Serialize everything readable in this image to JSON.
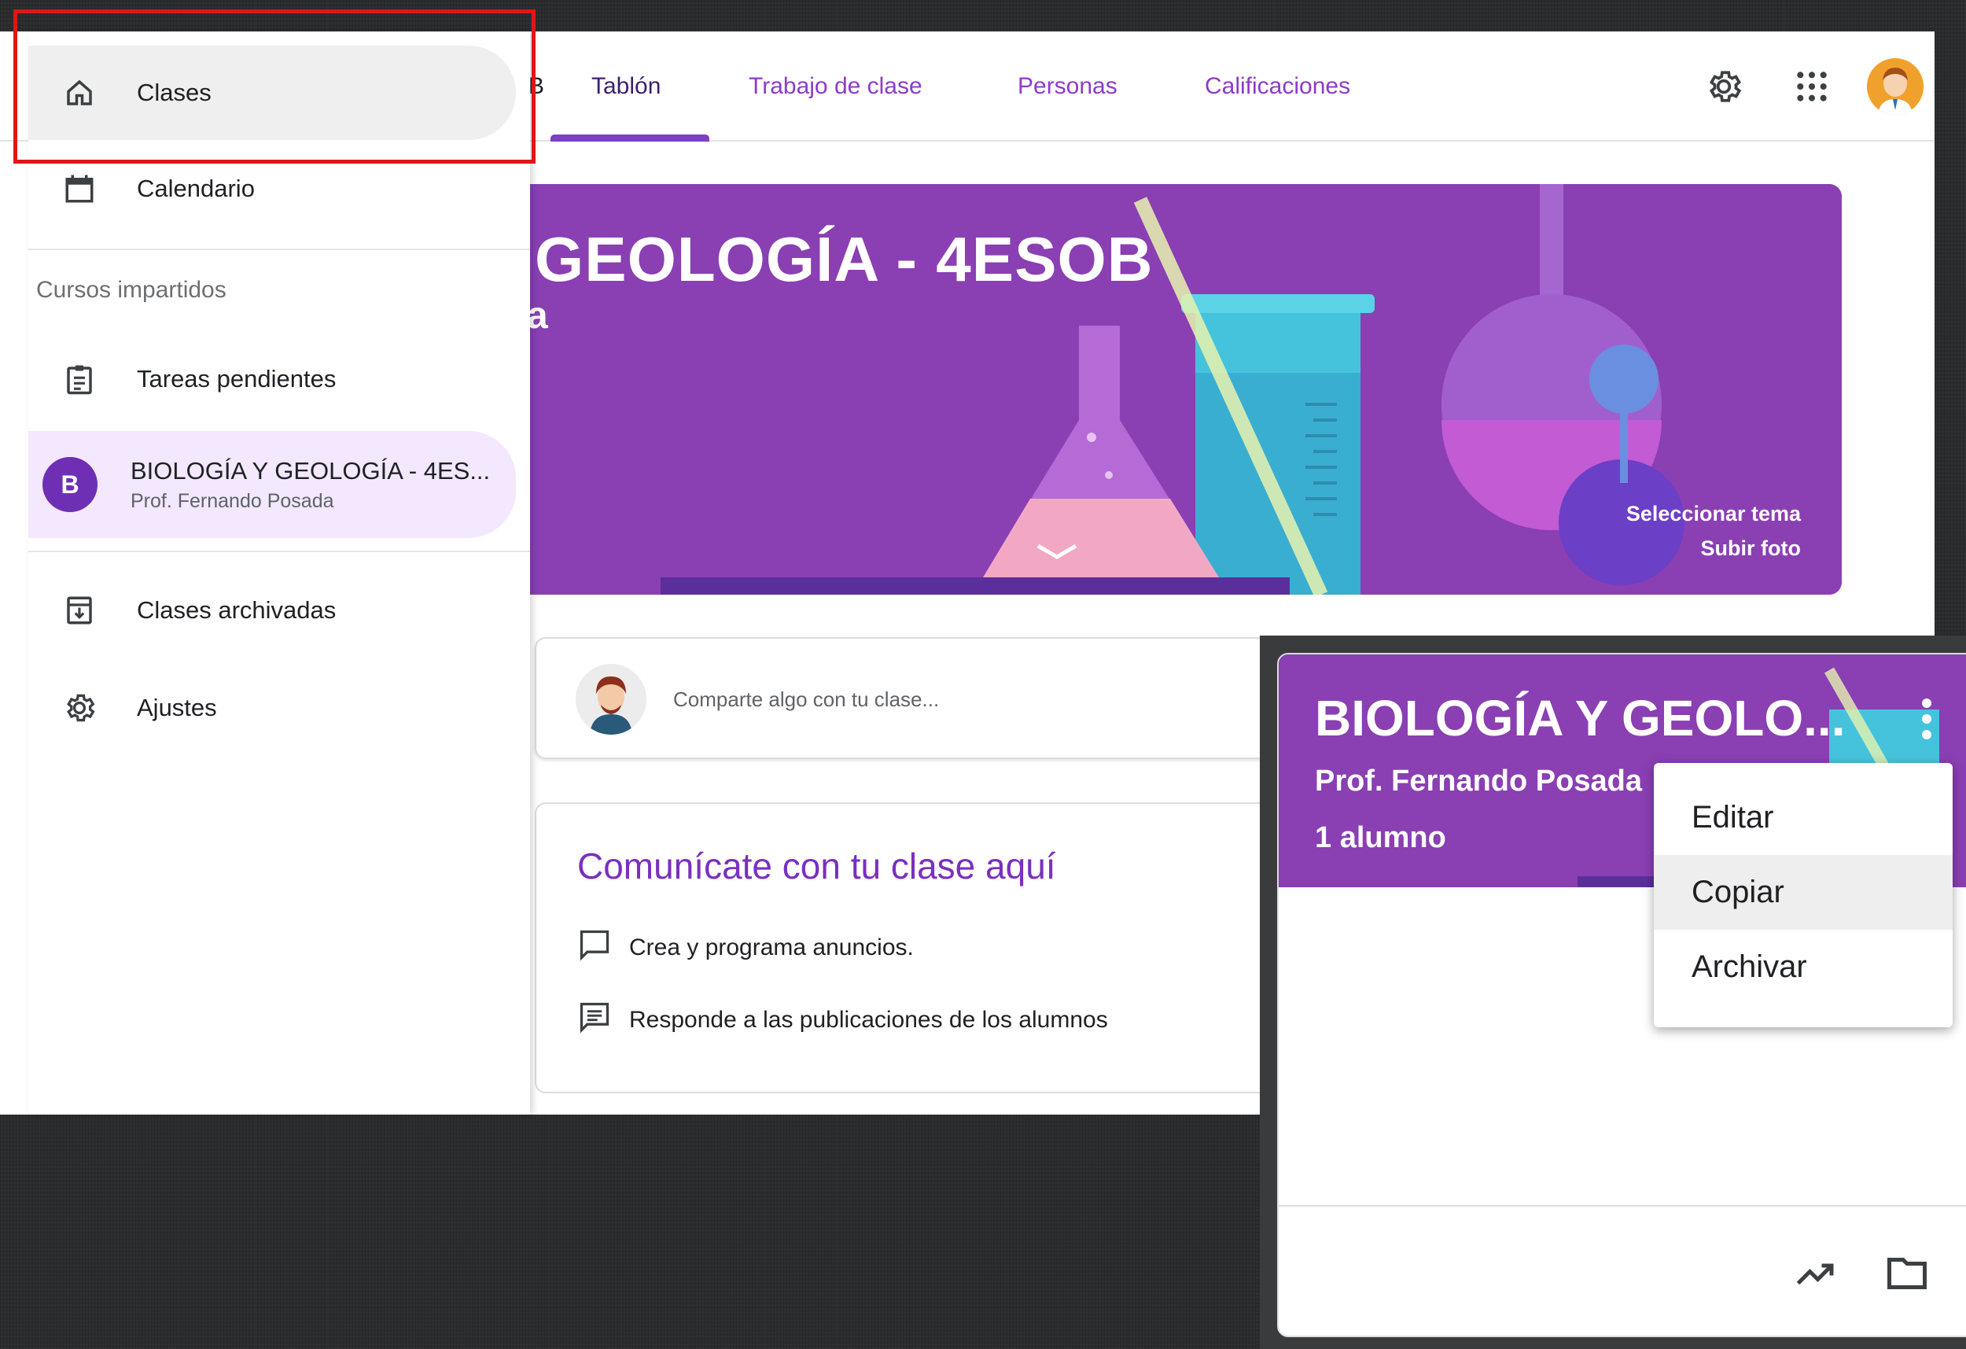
{
  "colors": {
    "accent": "#7b40c4",
    "banner": "#8a3fb3",
    "highlight": "#e01616",
    "course_badge": "#6e2fb5"
  },
  "header": {
    "tabs": [
      {
        "label": "Tablón",
        "active": true
      },
      {
        "label": "Trabajo de clase",
        "active": false
      },
      {
        "label": "Personas",
        "active": false
      },
      {
        "label": "Calificaciones",
        "active": false
      }
    ],
    "title_fragment": "B",
    "icons": [
      "gear-icon",
      "apps-grid-icon",
      "avatar"
    ]
  },
  "banner": {
    "title": "GEOLOGÍA - 4ESOB",
    "subtitle": "a",
    "select_theme": "Seleccionar tema",
    "upload_photo": "Subir foto"
  },
  "share": {
    "placeholder": "Comparte algo con tu clase..."
  },
  "communicate": {
    "title": "Comunícate con tu clase aquí",
    "items": [
      {
        "icon": "comment-icon",
        "label": "Crea y programa anuncios."
      },
      {
        "icon": "feedback-icon",
        "label": "Responde a las publicaciones de los alumnos"
      }
    ]
  },
  "drawer": {
    "items": [
      {
        "icon": "home-icon",
        "label": "Clases",
        "active": true
      },
      {
        "icon": "calendar-icon",
        "label": "Calendario"
      }
    ],
    "section_label": "Cursos impartidos",
    "todo": {
      "icon": "assignment-icon",
      "label": "Tareas pendientes"
    },
    "course": {
      "badge": "B",
      "name": "BIOLOGÍA Y GEOLOGÍA - 4ES...",
      "teacher": "Prof. Fernando Posada"
    },
    "archived": {
      "icon": "archive-icon",
      "label": "Clases archivadas"
    },
    "settings": {
      "icon": "gear-icon",
      "label": "Ajustes"
    }
  },
  "card": {
    "title": "BIOLOGÍA Y GEOLO...",
    "teacher": "Prof. Fernando Posada",
    "students": "1 alumno",
    "footer_icons": [
      "trending-up-icon",
      "folder-icon"
    ]
  },
  "context_menu": {
    "items": [
      {
        "label": "Editar",
        "hover": false
      },
      {
        "label": "Copiar",
        "hover": true
      },
      {
        "label": "Archivar",
        "hover": false
      }
    ]
  }
}
